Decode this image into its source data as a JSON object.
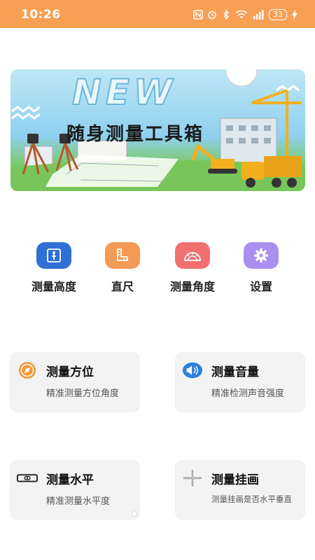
{
  "status_bar": {
    "time": "10:26",
    "battery": "33",
    "icons": [
      "nfc-icon",
      "alarm-icon",
      "bluetooth-icon",
      "wifi-icon",
      "signal-icon",
      "battery-icon",
      "charging-icon"
    ]
  },
  "banner": {
    "new_text": "NEW",
    "title": "随身测量工具箱"
  },
  "tools": [
    {
      "label": "测量高度",
      "icon": "person-height-icon",
      "color": "#2f6fd6"
    },
    {
      "label": "直尺",
      "icon": "ruler-icon",
      "color": "#f39a54"
    },
    {
      "label": "测量角度",
      "icon": "protractor-icon",
      "color": "#f07070"
    },
    {
      "label": "设置",
      "icon": "gear-icon",
      "color": "#a98ff0"
    }
  ],
  "cards": [
    {
      "title": "测量方位",
      "subtitle": "精准测量方位角度",
      "icon": "compass-icon",
      "color": "#f39a3c"
    },
    {
      "title": "测量音量",
      "subtitle": "精准检测声音强度",
      "icon": "sound-icon",
      "color": "#2f7fe0"
    },
    {
      "title": "测量水平",
      "subtitle": "精准测量水平度",
      "icon": "level-icon",
      "color": "#222222"
    },
    {
      "title": "测量挂画",
      "subtitle": "测量挂画是否水平垂直",
      "icon": "crosshair-icon",
      "color": "#888888"
    }
  ]
}
